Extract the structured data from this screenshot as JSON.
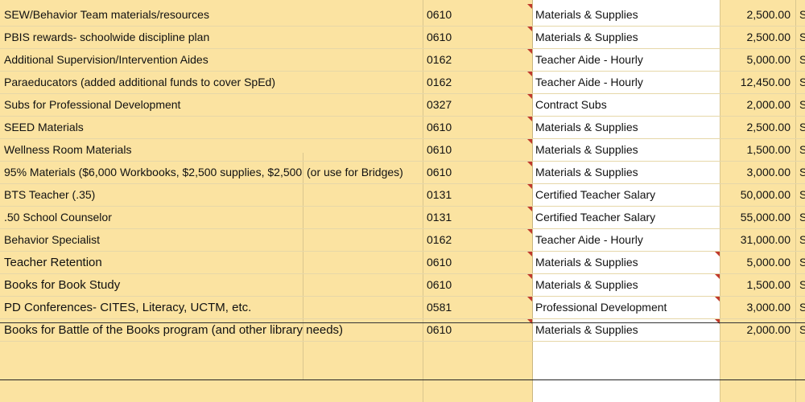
{
  "rows": [
    {
      "desc": "SEW/Behavior Team materials/resources",
      "extra": "",
      "code": "0610",
      "category": "Materials & Supplies",
      "amount": "2,500.00",
      "tail": "S"
    },
    {
      "desc": "PBIS rewards- schoolwide discipline plan",
      "extra": "",
      "code": "0610",
      "category": "Materials & Supplies",
      "amount": "2,500.00",
      "tail": "S"
    },
    {
      "desc": "Additional Supervision/Intervention Aides",
      "extra": "",
      "code": "0162",
      "category": "Teacher Aide - Hourly",
      "amount": "5,000.00",
      "tail": "S"
    },
    {
      "desc": "Paraeducators (added additional funds to cover SpEd)",
      "extra": "",
      "code": "0162",
      "category": "Teacher Aide - Hourly",
      "amount": "12,450.00",
      "tail": "S"
    },
    {
      "desc": "Subs for Professional Development",
      "extra": "",
      "code": "0327",
      "category": "Contract Subs",
      "amount": "2,000.00",
      "tail": "S"
    },
    {
      "desc": "SEED Materials",
      "extra": "",
      "code": "0610",
      "category": "Materials & Supplies",
      "amount": "2,500.00",
      "tail": "S"
    },
    {
      "desc": "Wellness Room Materials",
      "extra": "",
      "code": "0610",
      "category": "Materials & Supplies",
      "amount": "1,500.00",
      "tail": "S"
    },
    {
      "desc": "95% Materials ($6,000 Workbooks, $2,500 supplies, $2,500 S",
      "extra": "(or use for Bridges)",
      "code": "0610",
      "category": "Materials & Supplies",
      "amount": "3,000.00",
      "tail": "S"
    },
    {
      "desc": "BTS Teacher (.35)",
      "extra": "",
      "code": "0131",
      "category": "Certified Teacher Salary",
      "amount": "50,000.00",
      "tail": "S"
    },
    {
      "desc": ".50 School Counselor",
      "extra": "",
      "code": "0131",
      "category": "Certified Teacher Salary",
      "amount": "55,000.00",
      "tail": "S"
    },
    {
      "desc": "Behavior Specialist",
      "extra": "",
      "code": "0162",
      "category": "Teacher Aide - Hourly",
      "amount": "31,000.00",
      "tail": "S"
    },
    {
      "desc": "Teacher Retention",
      "extra": "",
      "code": "0610",
      "category": "Materials & Supplies",
      "amount": "5,000.00",
      "tail": "S"
    },
    {
      "desc": "Books for Book Study",
      "extra": "",
      "code": "0610",
      "category": "Materials & Supplies",
      "amount": "1,500.00",
      "tail": "S"
    },
    {
      "desc": "PD Conferences- CITES, Literacy, UCTM, etc.",
      "extra": "",
      "code": "0581",
      "category": "Professional Development",
      "amount": "3,000.00",
      "tail": "S"
    },
    {
      "desc": "Books for Battle of the Books program (and other library needs)",
      "extra": "",
      "code": "0610",
      "category": "Materials & Supplies",
      "amount": "2,000.00",
      "tail": "S"
    }
  ],
  "colors": {
    "cell_fill": "#fbe3a1",
    "white_fill": "#ffffff",
    "comment_marker": "#c0392b"
  }
}
